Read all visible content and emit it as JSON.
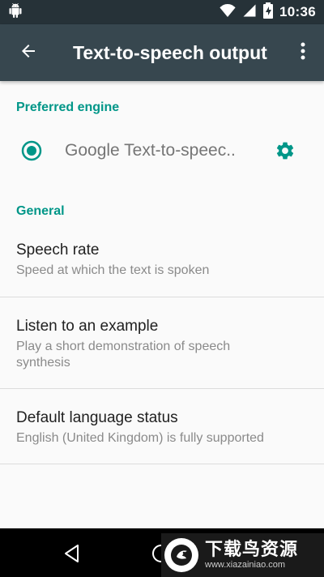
{
  "status_bar": {
    "time": "10:36",
    "icons": [
      "android-icon",
      "wifi-icon",
      "signal-icon",
      "battery-charging-icon"
    ]
  },
  "app_bar": {
    "title": "Text-to-speech output",
    "icons": [
      "back-arrow-icon",
      "more-vert-icon"
    ]
  },
  "preferred_engine": {
    "header": "Preferred engine",
    "engine_name": "Google Text-to-speec..",
    "selected": true
  },
  "general": {
    "header": "General",
    "items": [
      {
        "title": "Speech rate",
        "summary": "Speed at which the text is spoken"
      },
      {
        "title": "Listen to an example",
        "summary": "Play a short demonstration of speech synthesis"
      },
      {
        "title": "Default language status",
        "summary": "English (United Kingdom) is fully supported"
      }
    ]
  },
  "watermark": {
    "main": "下载鸟资源",
    "sub": "www.xiazainiao.com"
  },
  "colors": {
    "status_bar": "#263238",
    "app_bar": "#37474f",
    "accent": "#009688",
    "background": "#fafafa"
  }
}
